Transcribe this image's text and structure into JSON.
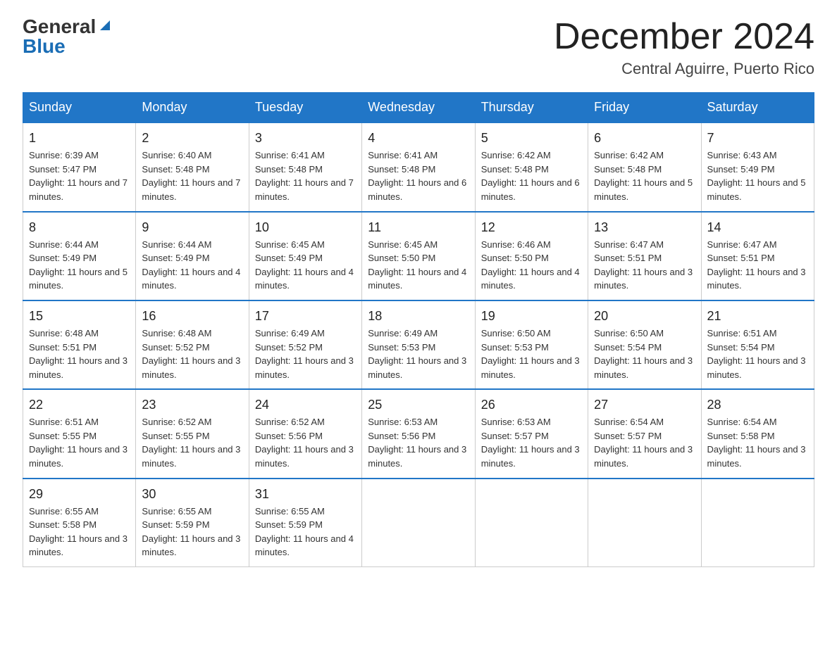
{
  "logo": {
    "general": "General",
    "blue": "Blue"
  },
  "title": "December 2024",
  "subtitle": "Central Aguirre, Puerto Rico",
  "days_of_week": [
    "Sunday",
    "Monday",
    "Tuesday",
    "Wednesday",
    "Thursday",
    "Friday",
    "Saturday"
  ],
  "weeks": [
    [
      {
        "day": "1",
        "sunrise": "6:39 AM",
        "sunset": "5:47 PM",
        "daylight": "11 hours and 7 minutes."
      },
      {
        "day": "2",
        "sunrise": "6:40 AM",
        "sunset": "5:48 PM",
        "daylight": "11 hours and 7 minutes."
      },
      {
        "day": "3",
        "sunrise": "6:41 AM",
        "sunset": "5:48 PM",
        "daylight": "11 hours and 7 minutes."
      },
      {
        "day": "4",
        "sunrise": "6:41 AM",
        "sunset": "5:48 PM",
        "daylight": "11 hours and 6 minutes."
      },
      {
        "day": "5",
        "sunrise": "6:42 AM",
        "sunset": "5:48 PM",
        "daylight": "11 hours and 6 minutes."
      },
      {
        "day": "6",
        "sunrise": "6:42 AM",
        "sunset": "5:48 PM",
        "daylight": "11 hours and 5 minutes."
      },
      {
        "day": "7",
        "sunrise": "6:43 AM",
        "sunset": "5:49 PM",
        "daylight": "11 hours and 5 minutes."
      }
    ],
    [
      {
        "day": "8",
        "sunrise": "6:44 AM",
        "sunset": "5:49 PM",
        "daylight": "11 hours and 5 minutes."
      },
      {
        "day": "9",
        "sunrise": "6:44 AM",
        "sunset": "5:49 PM",
        "daylight": "11 hours and 4 minutes."
      },
      {
        "day": "10",
        "sunrise": "6:45 AM",
        "sunset": "5:49 PM",
        "daylight": "11 hours and 4 minutes."
      },
      {
        "day": "11",
        "sunrise": "6:45 AM",
        "sunset": "5:50 PM",
        "daylight": "11 hours and 4 minutes."
      },
      {
        "day": "12",
        "sunrise": "6:46 AM",
        "sunset": "5:50 PM",
        "daylight": "11 hours and 4 minutes."
      },
      {
        "day": "13",
        "sunrise": "6:47 AM",
        "sunset": "5:51 PM",
        "daylight": "11 hours and 3 minutes."
      },
      {
        "day": "14",
        "sunrise": "6:47 AM",
        "sunset": "5:51 PM",
        "daylight": "11 hours and 3 minutes."
      }
    ],
    [
      {
        "day": "15",
        "sunrise": "6:48 AM",
        "sunset": "5:51 PM",
        "daylight": "11 hours and 3 minutes."
      },
      {
        "day": "16",
        "sunrise": "6:48 AM",
        "sunset": "5:52 PM",
        "daylight": "11 hours and 3 minutes."
      },
      {
        "day": "17",
        "sunrise": "6:49 AM",
        "sunset": "5:52 PM",
        "daylight": "11 hours and 3 minutes."
      },
      {
        "day": "18",
        "sunrise": "6:49 AM",
        "sunset": "5:53 PM",
        "daylight": "11 hours and 3 minutes."
      },
      {
        "day": "19",
        "sunrise": "6:50 AM",
        "sunset": "5:53 PM",
        "daylight": "11 hours and 3 minutes."
      },
      {
        "day": "20",
        "sunrise": "6:50 AM",
        "sunset": "5:54 PM",
        "daylight": "11 hours and 3 minutes."
      },
      {
        "day": "21",
        "sunrise": "6:51 AM",
        "sunset": "5:54 PM",
        "daylight": "11 hours and 3 minutes."
      }
    ],
    [
      {
        "day": "22",
        "sunrise": "6:51 AM",
        "sunset": "5:55 PM",
        "daylight": "11 hours and 3 minutes."
      },
      {
        "day": "23",
        "sunrise": "6:52 AM",
        "sunset": "5:55 PM",
        "daylight": "11 hours and 3 minutes."
      },
      {
        "day": "24",
        "sunrise": "6:52 AM",
        "sunset": "5:56 PM",
        "daylight": "11 hours and 3 minutes."
      },
      {
        "day": "25",
        "sunrise": "6:53 AM",
        "sunset": "5:56 PM",
        "daylight": "11 hours and 3 minutes."
      },
      {
        "day": "26",
        "sunrise": "6:53 AM",
        "sunset": "5:57 PM",
        "daylight": "11 hours and 3 minutes."
      },
      {
        "day": "27",
        "sunrise": "6:54 AM",
        "sunset": "5:57 PM",
        "daylight": "11 hours and 3 minutes."
      },
      {
        "day": "28",
        "sunrise": "6:54 AM",
        "sunset": "5:58 PM",
        "daylight": "11 hours and 3 minutes."
      }
    ],
    [
      {
        "day": "29",
        "sunrise": "6:55 AM",
        "sunset": "5:58 PM",
        "daylight": "11 hours and 3 minutes."
      },
      {
        "day": "30",
        "sunrise": "6:55 AM",
        "sunset": "5:59 PM",
        "daylight": "11 hours and 3 minutes."
      },
      {
        "day": "31",
        "sunrise": "6:55 AM",
        "sunset": "5:59 PM",
        "daylight": "11 hours and 4 minutes."
      },
      null,
      null,
      null,
      null
    ]
  ]
}
